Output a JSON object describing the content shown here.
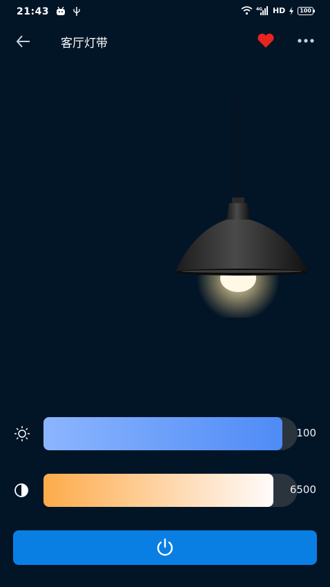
{
  "status_bar": {
    "time": "21:43",
    "network": "HD",
    "battery": "100"
  },
  "header": {
    "title": "客厅灯带",
    "favorite_color": "#e8241f"
  },
  "controls": {
    "brightness": {
      "value": "100",
      "level": 1.0
    },
    "color_temperature": {
      "value": "6500",
      "level": 1.0
    }
  },
  "colors": {
    "background": "#021527",
    "accent": "#0a7fe3",
    "brightness_gradient": [
      "#8cb5fe",
      "#4f8bf6"
    ],
    "temperature_gradient": [
      "#fdab4a",
      "#fffbfb"
    ]
  },
  "icons": {
    "back": "arrow-left-icon",
    "favorite": "heart-icon",
    "more": "more-dots-icon",
    "brightness": "sun-icon",
    "temperature": "contrast-icon",
    "power": "power-icon"
  }
}
